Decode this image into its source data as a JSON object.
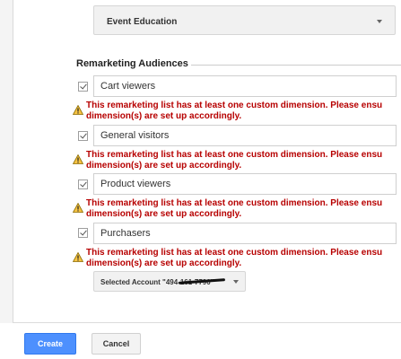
{
  "event_dropdown": {
    "value": "Event Education"
  },
  "remarketing": {
    "title": "Remarketing Audiences",
    "warning_line1": "This remarketing list has at least one custom dimension. Please ensu",
    "warning_line2": "dimension(s) are set up accordingly.",
    "items": [
      {
        "label": "Cart viewers",
        "checked": true
      },
      {
        "label": "General visitors",
        "checked": true
      },
      {
        "label": "Product viewers",
        "checked": true
      },
      {
        "label": "Purchasers",
        "checked": true
      }
    ]
  },
  "account_select": {
    "text": "Selected Account \"494-161-7790\""
  },
  "footer": {
    "create_label": "Create",
    "cancel_label": "Cancel"
  },
  "colors": {
    "primary": "#4d90fe",
    "warning": "#b70000"
  }
}
